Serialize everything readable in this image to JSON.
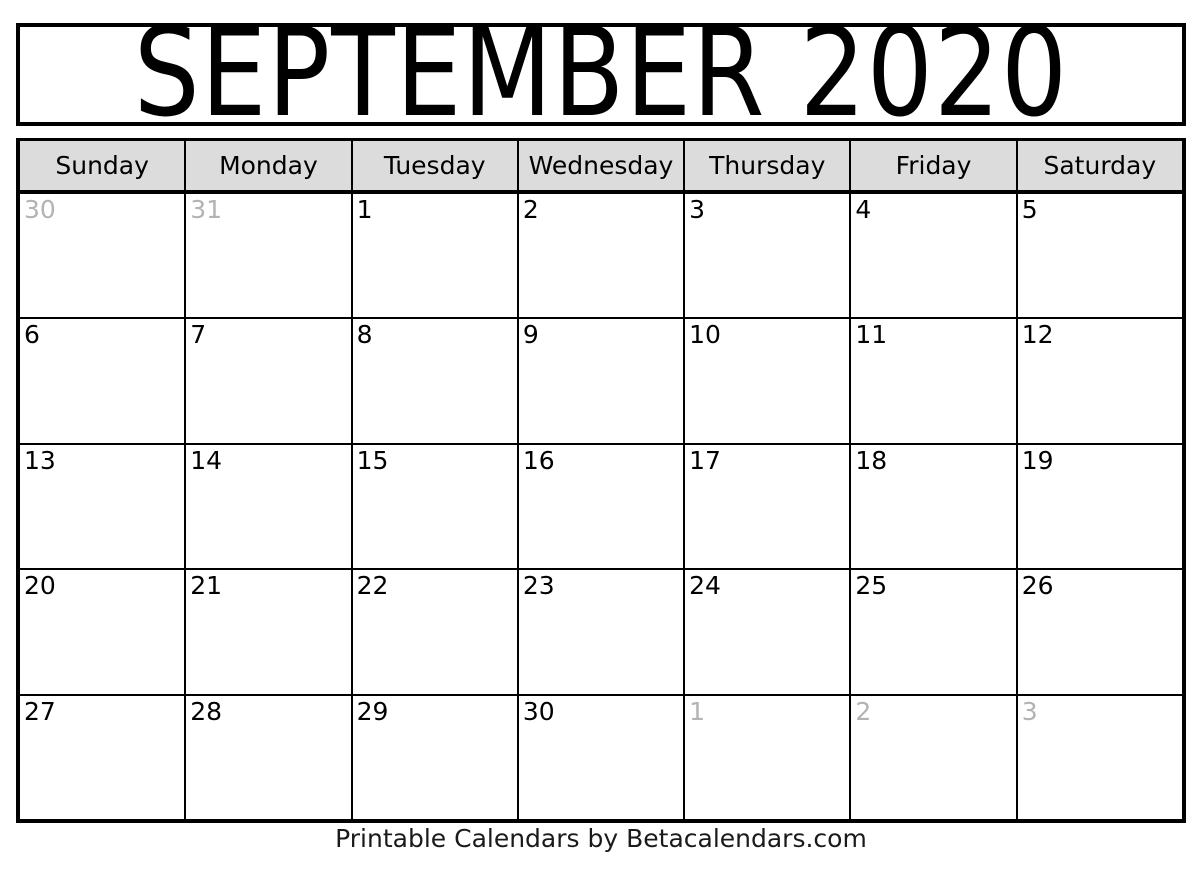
{
  "calendar": {
    "title": "SEPTEMBER 2020",
    "month": "September",
    "year": "2020",
    "weekdays": [
      "Sunday",
      "Monday",
      "Tuesday",
      "Wednesday",
      "Thursday",
      "Friday",
      "Saturday"
    ],
    "weeks": [
      [
        {
          "num": "30",
          "muted": true
        },
        {
          "num": "31",
          "muted": true
        },
        {
          "num": "1",
          "muted": false
        },
        {
          "num": "2",
          "muted": false
        },
        {
          "num": "3",
          "muted": false
        },
        {
          "num": "4",
          "muted": false
        },
        {
          "num": "5",
          "muted": false
        }
      ],
      [
        {
          "num": "6",
          "muted": false
        },
        {
          "num": "7",
          "muted": false
        },
        {
          "num": "8",
          "muted": false
        },
        {
          "num": "9",
          "muted": false
        },
        {
          "num": "10",
          "muted": false
        },
        {
          "num": "11",
          "muted": false
        },
        {
          "num": "12",
          "muted": false
        }
      ],
      [
        {
          "num": "13",
          "muted": false
        },
        {
          "num": "14",
          "muted": false
        },
        {
          "num": "15",
          "muted": false
        },
        {
          "num": "16",
          "muted": false
        },
        {
          "num": "17",
          "muted": false
        },
        {
          "num": "18",
          "muted": false
        },
        {
          "num": "19",
          "muted": false
        }
      ],
      [
        {
          "num": "20",
          "muted": false
        },
        {
          "num": "21",
          "muted": false
        },
        {
          "num": "22",
          "muted": false
        },
        {
          "num": "23",
          "muted": false
        },
        {
          "num": "24",
          "muted": false
        },
        {
          "num": "25",
          "muted": false
        },
        {
          "num": "26",
          "muted": false
        }
      ],
      [
        {
          "num": "27",
          "muted": false
        },
        {
          "num": "28",
          "muted": false
        },
        {
          "num": "29",
          "muted": false
        },
        {
          "num": "30",
          "muted": false
        },
        {
          "num": "1",
          "muted": true
        },
        {
          "num": "2",
          "muted": true
        },
        {
          "num": "3",
          "muted": true
        }
      ]
    ]
  },
  "footer": {
    "text": "Printable Calendars by Betacalendars.com"
  },
  "colors": {
    "border": "#000000",
    "weekday_header_bg": "#dcdcdc",
    "day_text": "#000000",
    "muted_day_text": "#b3b3b3",
    "page_bg": "#ffffff"
  }
}
